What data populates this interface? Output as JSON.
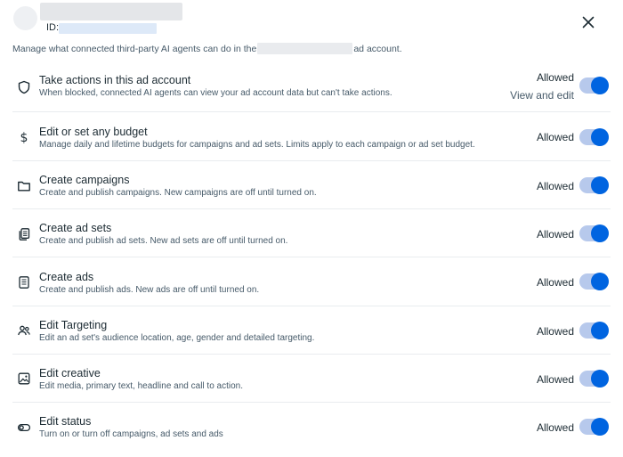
{
  "header": {
    "id_label": "ID:",
    "close_icon": "close-icon"
  },
  "description": {
    "before": "Manage what connected third-party AI agents can do in the",
    "after": "ad account."
  },
  "permissions": [
    {
      "icon": "shield-icon",
      "title": "Take actions in this ad account",
      "subtitle": "When blocked, connected AI agents can view your ad account data but can't take actions.",
      "status": "Allowed",
      "extra": "View and edit",
      "enabled": true
    },
    {
      "icon": "dollar-icon",
      "title": "Edit or set any budget",
      "subtitle": "Manage daily and lifetime budgets for campaigns and ad sets. Limits apply to each campaign or ad set budget.",
      "status": "Allowed",
      "enabled": true
    },
    {
      "icon": "folder-icon",
      "title": "Create campaigns",
      "subtitle": "Create and publish campaigns. New campaigns are off until turned on.",
      "status": "Allowed",
      "enabled": true
    },
    {
      "icon": "ad-sets-icon",
      "title": "Create ad sets",
      "subtitle": "Create and publish ad sets. New ad sets are off until turned on.",
      "status": "Allowed",
      "enabled": true
    },
    {
      "icon": "ad-document-icon",
      "title": "Create ads",
      "subtitle": "Create and publish ads. New ads are off until turned on.",
      "status": "Allowed",
      "enabled": true
    },
    {
      "icon": "people-icon",
      "title": "Edit Targeting",
      "subtitle": "Edit an ad set's audience location, age, gender and detailed targeting.",
      "status": "Allowed",
      "enabled": true
    },
    {
      "icon": "image-icon",
      "title": "Edit creative",
      "subtitle": "Edit media, primary text, headline and call to action.",
      "status": "Allowed",
      "enabled": true
    },
    {
      "icon": "toggle-status-icon",
      "title": "Edit status",
      "subtitle": "Turn on or turn off campaigns, ad sets and ads",
      "status": "Allowed",
      "enabled": true
    }
  ],
  "colors": {
    "toggle_on_knob": "#0064e0",
    "toggle_on_track": "#b7c9ec",
    "text_primary": "#1c2b33",
    "text_secondary": "#465a69"
  }
}
